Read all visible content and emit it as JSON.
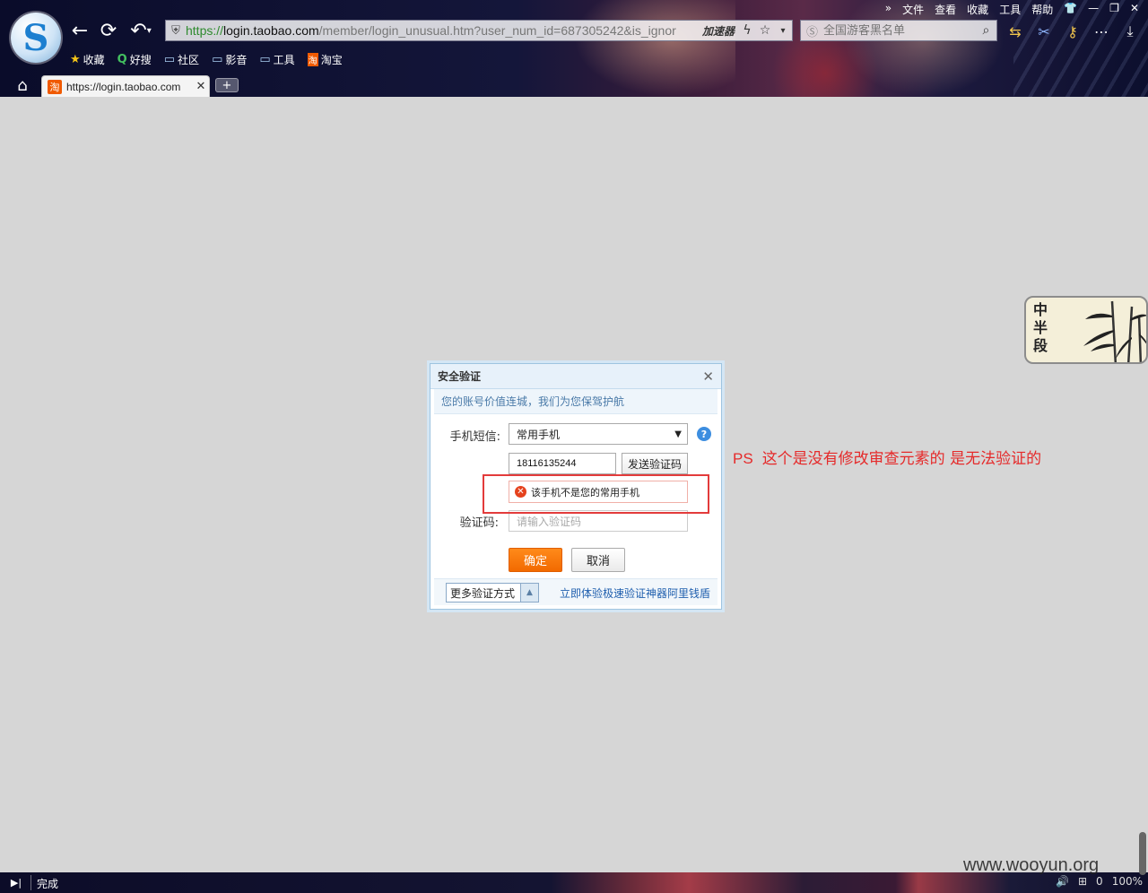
{
  "browser": {
    "logo_letter": "S",
    "menu": [
      "»",
      "文件",
      "查看",
      "收藏",
      "工具",
      "帮助",
      "👕",
      "—",
      "❐",
      "✕"
    ],
    "url_proto": "https://",
    "url_host": "login.taobao.com",
    "url_rest": "/member/login_unusual.htm?user_num_id=687305242&is_ignor",
    "accelerator": "加速器",
    "search_placeholder": "全国游客黑名单",
    "favorites": [
      {
        "icon": "star-icon",
        "glyph": "★",
        "label": "收藏"
      },
      {
        "icon": "haosou-icon",
        "glyph": "Q",
        "label": "好搜"
      },
      {
        "icon": "folder-icon",
        "glyph": "▭",
        "label": "社区"
      },
      {
        "icon": "folder-icon",
        "glyph": "▭",
        "label": "影音"
      },
      {
        "icon": "folder-icon",
        "glyph": "▭",
        "label": "工具"
      },
      {
        "icon": "taobao-icon",
        "glyph": "淘",
        "label": "淘宝"
      }
    ],
    "tab": {
      "favicon": "淘",
      "label": "https://login.taobao.com",
      "close": "✕"
    },
    "new_tab": "+",
    "status": {
      "text": "完成",
      "right": [
        "🔊",
        "⊞",
        "0",
        "100%"
      ]
    }
  },
  "dialog": {
    "title": "安全验证",
    "close": "✕",
    "subtitle": "您的账号价值连城，我们为您保驾护航",
    "sms_label": "手机短信:",
    "sms_method": "常用手机",
    "help": "?",
    "phone_value": "18116135244",
    "send_code": "发送验证码",
    "error_text": "该手机不是您的常用手机",
    "code_label": "验证码:",
    "code_placeholder": "请输入验证码",
    "ok": "确定",
    "cancel": "取消",
    "more_methods": "更多验证方式",
    "alipay_link": "立即体验极速验证神器阿里钱盾"
  },
  "annotation": {
    "ps": "PS",
    "text": "这个是没有修改审查元素的  是无法验证的"
  },
  "widget": {
    "calligraphy": "中半段"
  },
  "watermark": "www.wooyun.org",
  "colors": {
    "accent_orange": "#f26a00",
    "annotation_red": "#e52a2a",
    "link_blue": "#1f5fae"
  }
}
